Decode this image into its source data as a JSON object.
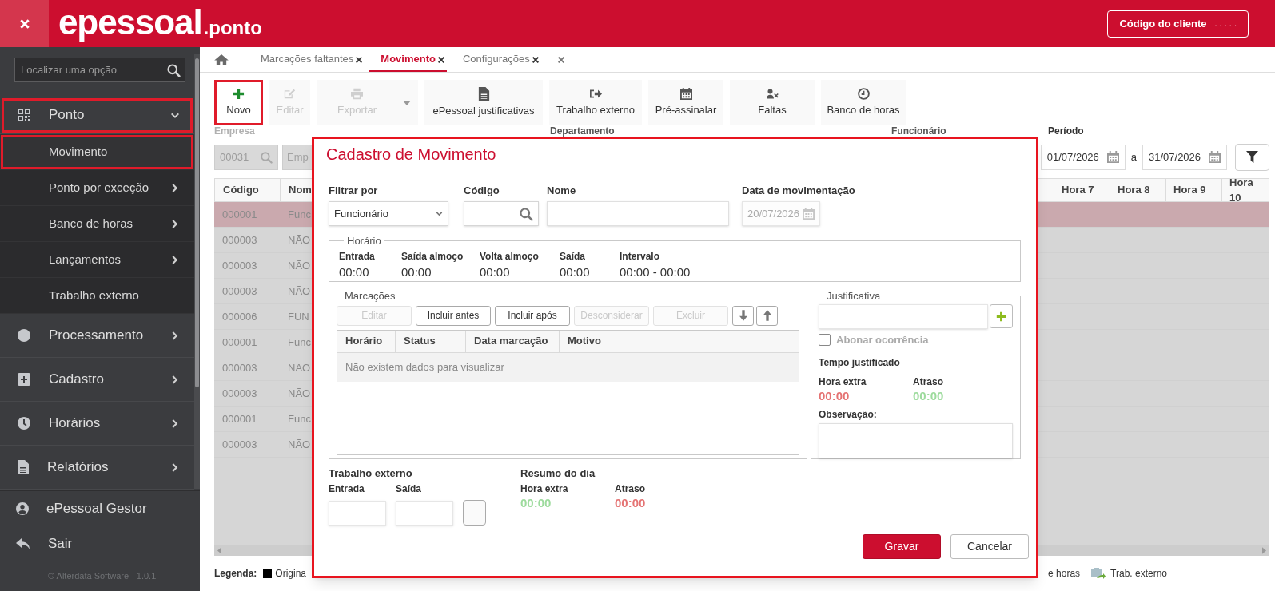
{
  "header": {
    "brand": "epessoal",
    "product": ".ponto",
    "client_button": {
      "label": "Código do cliente",
      "value": ". . . . ."
    }
  },
  "sidebar": {
    "search_placeholder": "Localizar uma opção",
    "menu": [
      {
        "label": "Ponto",
        "expanded": true,
        "highlighted": true,
        "children": [
          {
            "label": "Movimento",
            "selected": true,
            "highlighted": true,
            "has_submenu": false
          },
          {
            "label": "Ponto por exceção",
            "selected": false,
            "highlighted": false,
            "has_submenu": true
          },
          {
            "label": "Banco de horas",
            "selected": false,
            "highlighted": false,
            "has_submenu": true
          },
          {
            "label": "Lançamentos",
            "selected": false,
            "highlighted": false,
            "has_submenu": true
          },
          {
            "label": "Trabalho externo",
            "selected": false,
            "highlighted": false,
            "has_submenu": false
          }
        ]
      },
      {
        "label": "Processamento",
        "expanded": false,
        "highlighted": false
      },
      {
        "label": "Cadastro",
        "expanded": false,
        "highlighted": false
      },
      {
        "label": "Horários",
        "expanded": false,
        "highlighted": false
      },
      {
        "label": "Relatórios",
        "expanded": false,
        "highlighted": false
      }
    ],
    "footer_items": [
      "ePessoal Gestor",
      "Sair"
    ],
    "copyright": "© Alterdata Software - 1.0.1"
  },
  "tabs": [
    {
      "label": "Marcações faltantes",
      "selected": false
    },
    {
      "label": "Movimento",
      "selected": true
    },
    {
      "label": "Configurações",
      "selected": false
    }
  ],
  "toolbar": [
    {
      "label": "Novo",
      "disabled": false,
      "highlighted": true
    },
    {
      "label": "Editar",
      "disabled": true,
      "highlighted": false
    },
    {
      "label": "Exportar",
      "disabled": true,
      "highlighted": false
    },
    {
      "label": "ePessoal justificativas",
      "disabled": false,
      "highlighted": false
    },
    {
      "label": "Trabalho externo",
      "disabled": false,
      "highlighted": false
    },
    {
      "label": "Pré-assinalar",
      "disabled": false,
      "highlighted": false
    },
    {
      "label": "Faltas",
      "disabled": false,
      "highlighted": false
    },
    {
      "label": "Banco de horas",
      "disabled": false,
      "highlighted": false
    }
  ],
  "filters": {
    "empresa": {
      "label": "Empresa",
      "code": "00031",
      "name_placeholder": "Emp"
    },
    "departamento": {
      "label": "Departamento"
    },
    "funcionario": {
      "label": "Funcionário"
    },
    "periodo": {
      "label": "Período",
      "start": "01/07/2026",
      "separator": "a",
      "end": "31/07/2026"
    }
  },
  "table": {
    "left_columns": [
      "Código",
      "Nom"
    ],
    "right_columns": [
      "Hora 7",
      "Hora 8",
      "Hora 9",
      "Hora 10"
    ],
    "rows": [
      {
        "code": "000001",
        "name": "Func",
        "selected": true
      },
      {
        "code": "000003",
        "name": "NÃO",
        "selected": false
      },
      {
        "code": "000003",
        "name": "NÃO",
        "selected": false
      },
      {
        "code": "000003",
        "name": "NÃO",
        "selected": false
      },
      {
        "code": "000006",
        "name": "FUN",
        "selected": false
      },
      {
        "code": "000001",
        "name": "Func",
        "selected": false
      },
      {
        "code": "000003",
        "name": "NÃO",
        "selected": false
      },
      {
        "code": "000003",
        "name": "NÃO",
        "selected": false
      },
      {
        "code": "000001",
        "name": "Func",
        "selected": false
      },
      {
        "code": "000003",
        "name": "NÃO",
        "selected": false
      }
    ]
  },
  "legend": {
    "title": "Legenda:",
    "left_item": "Origina",
    "right_items": [
      "e horas",
      "Trab. externo"
    ]
  },
  "modal": {
    "title": "Cadastro de Movimento",
    "highlighted": true,
    "filter": {
      "label": "Filtrar por",
      "value": "Funcionário"
    },
    "code": {
      "label": "Código"
    },
    "name": {
      "label": "Nome"
    },
    "date": {
      "label": "Data de movimentação",
      "value": "20/07/2026",
      "disabled": true
    },
    "schedule": {
      "title": "Horário",
      "items": [
        {
          "label": "Entrada",
          "value": "00:00"
        },
        {
          "label": "Saída almoço",
          "value": "00:00"
        },
        {
          "label": "Volta almoço",
          "value": "00:00"
        },
        {
          "label": "Saída",
          "value": "00:00"
        },
        {
          "label": "Intervalo",
          "value": "00:00 - 00:00"
        }
      ]
    },
    "punches": {
      "title": "Marcações",
      "buttons": [
        {
          "label": "Editar",
          "disabled": true
        },
        {
          "label": "Incluir antes",
          "disabled": false
        },
        {
          "label": "Incluir após",
          "disabled": false
        },
        {
          "label": "Desconsiderar",
          "disabled": true
        },
        {
          "label": "Excluir",
          "disabled": true
        }
      ],
      "columns": [
        "Horário",
        "Status",
        "Data marcação",
        "Motivo"
      ],
      "empty_message": "Não existem dados para visualizar"
    },
    "justification": {
      "title": "Justificativa",
      "waive": {
        "label": "Abonar ocorrência",
        "checked": false,
        "disabled": true
      },
      "time_title": "Tempo justificado",
      "times": [
        {
          "label": "Hora extra",
          "value": "00:00",
          "color": "#e57373"
        },
        {
          "label": "Atraso",
          "value": "00:00",
          "color": "#9ddb9d"
        }
      ],
      "note_label": "Observação:"
    },
    "external_work": {
      "title": "Trabalho externo",
      "fields": [
        "Entrada",
        "Saída"
      ]
    },
    "day_summary": {
      "title": "Resumo do dia",
      "times": [
        {
          "label": "Hora extra",
          "value": "00:00",
          "color": "#9ddb9d"
        },
        {
          "label": "Atraso",
          "value": "00:00",
          "color": "#e57373"
        }
      ]
    },
    "actions": [
      {
        "label": "Gravar",
        "primary": true
      },
      {
        "label": "Cancelar",
        "primary": false
      }
    ]
  }
}
